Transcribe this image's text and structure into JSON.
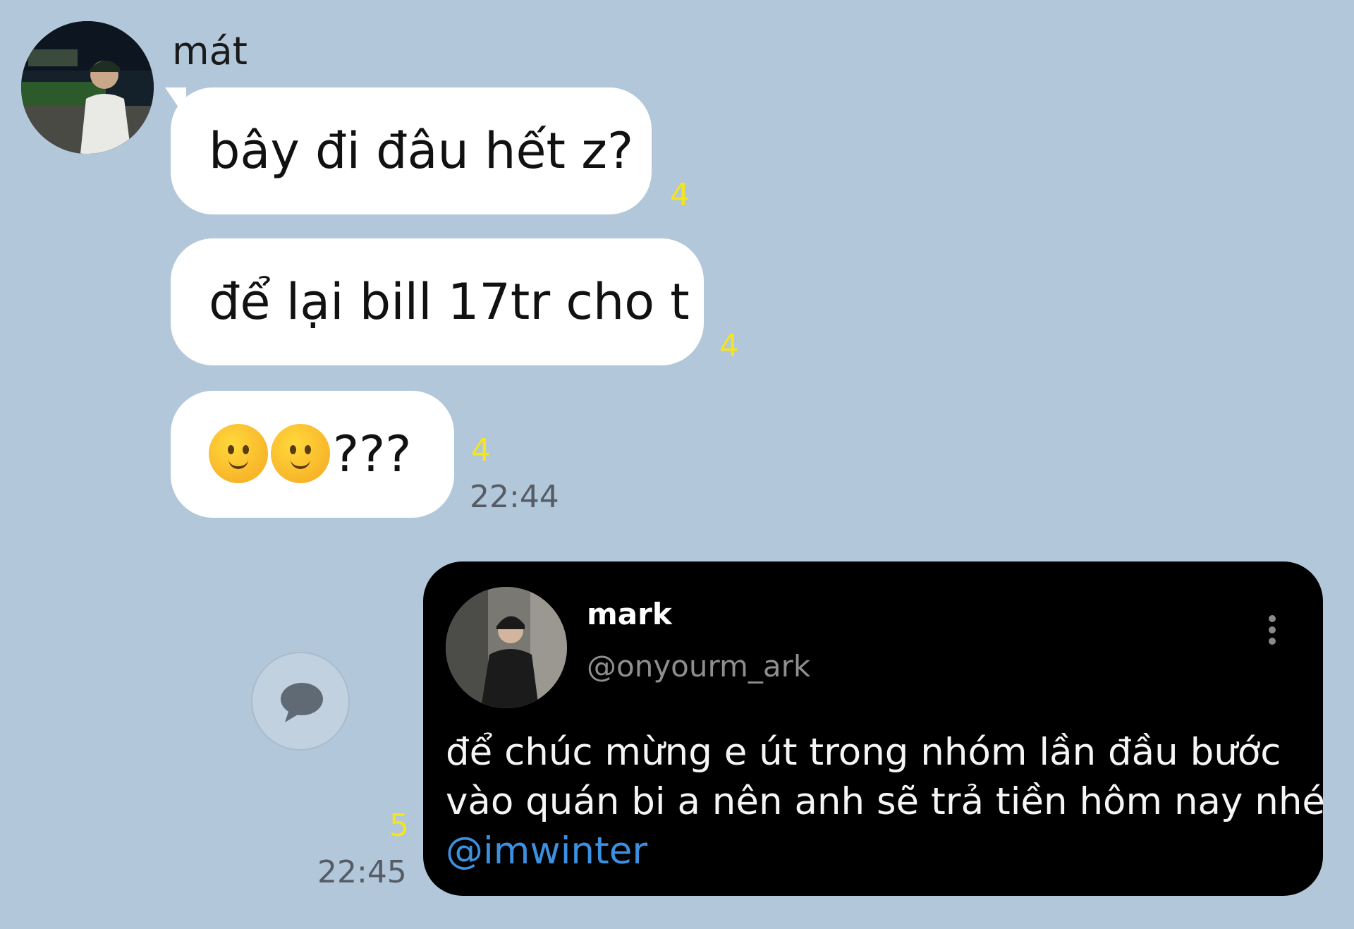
{
  "chat": {
    "sender": {
      "name": "mát"
    },
    "messages": [
      {
        "text": "bây đi đâu hết z?",
        "unread_count": "4"
      },
      {
        "text": "để lại bill 17tr cho t",
        "unread_count": "4"
      },
      {
        "text": "???",
        "emoji": [
          "slightly-smiling-face",
          "slightly-smiling-face"
        ],
        "unread_count": "4",
        "time": "22:44"
      }
    ],
    "shared_post": {
      "author_name": "mark",
      "author_handle": "@onyourm_ark",
      "body_lines": [
        "để chúc mừng e út trong nhóm lần đầu bước",
        "vào quán bi a nên anh sẽ trả tiền hôm nay nhé"
      ],
      "mention": "@imwinter",
      "unread_count": "5",
      "time": "22:45"
    }
  },
  "colors": {
    "background": "#b2c7da",
    "bubble": "#ffffff",
    "unread_count": "#f4e51c",
    "timestamp": "#555c66",
    "card_background": "#000000",
    "mention": "#3d8fe0"
  },
  "icons": [
    "speech-bubble-icon",
    "more-vertical-icon"
  ]
}
